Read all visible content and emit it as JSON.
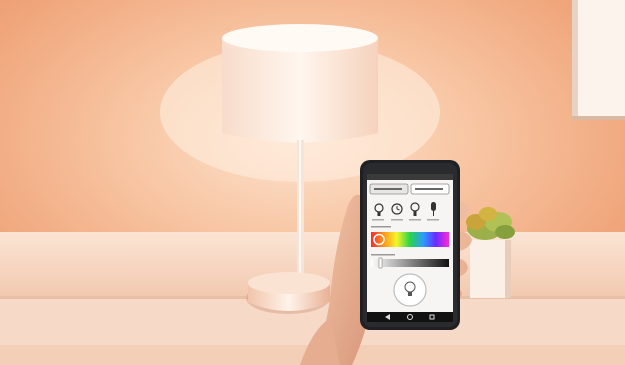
{
  "scene": {
    "description_items": [
      "lamp",
      "table",
      "potted-plant",
      "hand",
      "smartphone"
    ],
    "phone_screen": {
      "tabs": [
        "",
        ""
      ],
      "icons": [
        "lightbulb-icon",
        "clock-icon",
        "lightbulb-icon",
        "microphone-icon"
      ]
    }
  },
  "colors": {
    "wall_warm": "#f4b78e",
    "wall_glow": "#fde3cf",
    "lamp_shade": "#fdeee3",
    "table_top": "#f7dccb",
    "phone_body": "#1f2023"
  }
}
